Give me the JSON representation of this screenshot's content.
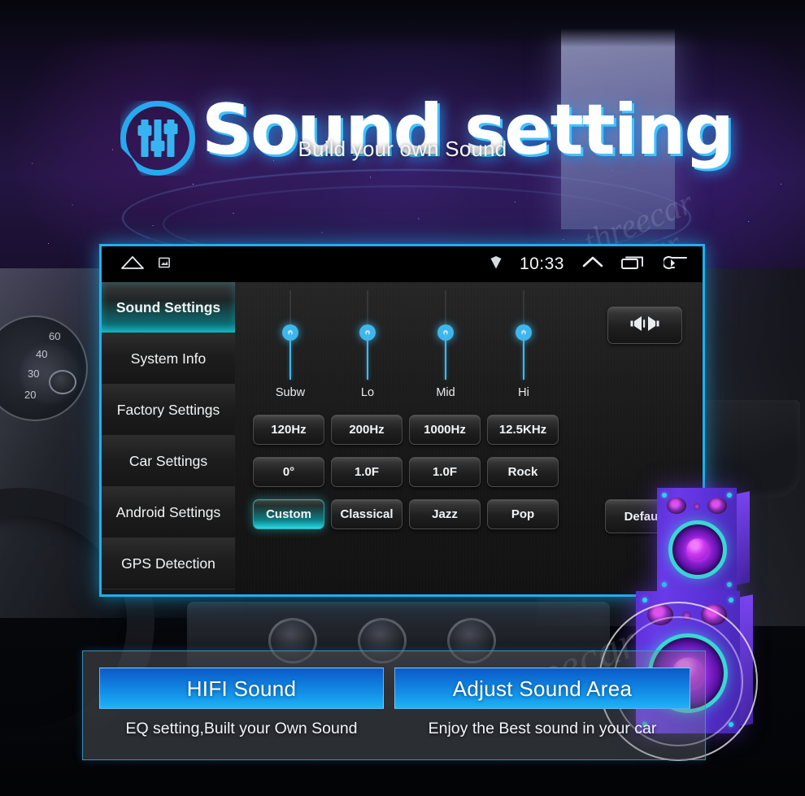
{
  "header": {
    "title": "Sound setting",
    "subtitle": "Build your own Sound",
    "logo_icon": "equalizer-circle-icon"
  },
  "watermark": {
    "text": "threecar"
  },
  "tablet": {
    "statusbar": {
      "home_icon": "home-icon",
      "screenshot_icon": "screenshot-icon",
      "signal_icon": "signal-diamond-icon",
      "time": "10:33",
      "up_icon": "chevron-up-icon",
      "recents_icon": "recent-apps-icon",
      "back_icon": "back-arrow-icon"
    },
    "sidebar": {
      "items": [
        {
          "label": "Sound Settings",
          "active": true
        },
        {
          "label": "System Info",
          "active": false
        },
        {
          "label": "Factory Settings",
          "active": false
        },
        {
          "label": "Car Settings",
          "active": false
        },
        {
          "label": "Android Settings",
          "active": false
        },
        {
          "label": "GPS Detection",
          "active": false
        }
      ]
    },
    "equalizer": {
      "sliders": [
        {
          "label": "Subw",
          "value": 52
        },
        {
          "label": "Lo",
          "value": 52
        },
        {
          "label": "Mid",
          "value": 52
        },
        {
          "label": "Hi",
          "value": 52
        }
      ],
      "balance_button": {
        "icon": "balance-speakers-icon"
      },
      "default_button": {
        "label": "Default"
      },
      "rows": [
        [
          {
            "label": "120Hz",
            "selected": false
          },
          {
            "label": "200Hz",
            "selected": false
          },
          {
            "label": "1000Hz",
            "selected": false
          },
          {
            "label": "12.5KHz",
            "selected": false
          }
        ],
        [
          {
            "label": "0°",
            "selected": false
          },
          {
            "label": "1.0F",
            "selected": false
          },
          {
            "label": "1.0F",
            "selected": false
          },
          {
            "label": "Rock",
            "selected": false
          }
        ],
        [
          {
            "label": "Custom",
            "selected": true
          },
          {
            "label": "Classical",
            "selected": false
          },
          {
            "label": "Jazz",
            "selected": false
          },
          {
            "label": "Pop",
            "selected": false
          }
        ]
      ]
    }
  },
  "features": [
    {
      "button": "HIFI Sound",
      "caption": "EQ setting,Built your Own Sound"
    },
    {
      "button": "Adjust Sound Area",
      "caption": "Enjoy the Best sound in your car"
    }
  ],
  "gauge_ticks": [
    "60",
    "40",
    "30",
    "20"
  ],
  "colors": {
    "accent_cyan": "#1fb0ee",
    "selected_teal": "#28dbe4",
    "slider_blue": "#3fb7ec",
    "feature_blue": "#1497ec"
  }
}
